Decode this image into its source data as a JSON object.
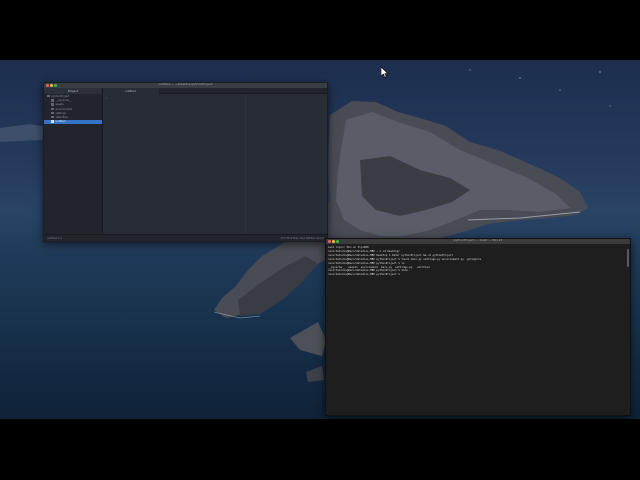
{
  "atom": {
    "title": "untitled — ~/Desktop/pythonProject",
    "tree_header": "Project",
    "project_root": "pythonProject",
    "tree_items": [
      "__pycache__",
      "assets",
      "environment",
      "settings",
      "staticfiles",
      "untitled"
    ],
    "tab_label": "untitled",
    "line_number": "1",
    "status_left": "untitled  1:1",
    "status_right": "LF  UTF-8  Plain Text  GitHub  Git (0)"
  },
  "terminal": {
    "title": "pythonProject — -bash — 80×24",
    "lines": [
      "Last login: Mon on ttys000",
      "recordstudio@Recordstudios-MBP ~ % cd Desktop/",
      "recordstudio@Recordstudios-MBP Desktop % mkdir pythonProject && cd pythonProject",
      "recordstudio@Recordstudios-MBP pythonProject % touch main.py settings.py environment.py .gitignore",
      "recordstudio@Recordstudios-MBP pythonProject % ls",
      "__pycache__  assets  environment  main.py  settings.py   untitled",
      "recordstudio@Recordstudios-MBP pythonProject % atom .",
      "recordstudio@Recordstudios-MBP pythonProject % "
    ]
  },
  "colors": {
    "selection": "#3574c4",
    "editor_bg": "#282c34",
    "terminal_bg": "#1e1e1e",
    "close": "#ff5f57",
    "minimize": "#febc2e",
    "zoom": "#28c840"
  }
}
